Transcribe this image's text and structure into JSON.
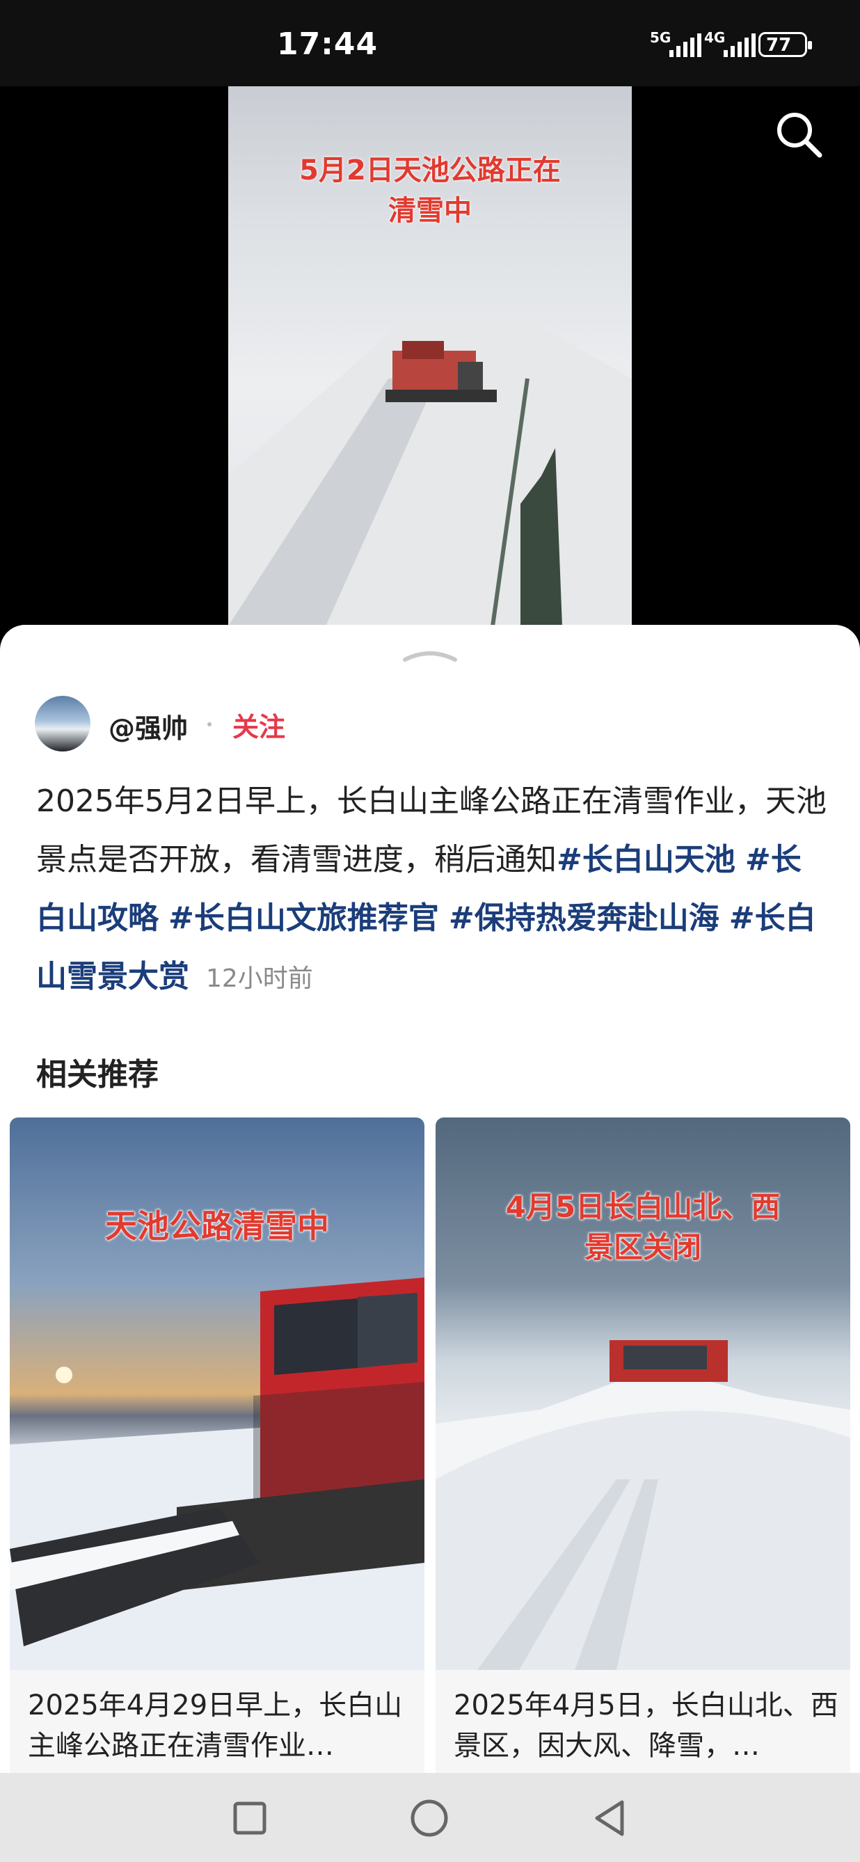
{
  "status_bar": {
    "time": "17:44",
    "signal_1_label": "5G",
    "signal_2_label": "4G",
    "battery": "77"
  },
  "video": {
    "overlay_title_line1": "5月2日天池公路正在",
    "overlay_title_line2": "清雪中",
    "search_icon": "search-icon"
  },
  "post": {
    "username": "@强帅",
    "follow_label": "关注",
    "text": "2025年5月2日早上，长白山主峰公路正在清雪作业，天池景点是否开放，看清雪进度，稍后通知",
    "tags": [
      "#长白山天池",
      "#长白山攻略",
      "#长白山文旅推荐官",
      "#保持热爱奔赴山海",
      "#长白山雪景大赏"
    ],
    "timestamp": "12小时前"
  },
  "related": {
    "title": "相关推荐",
    "cards": [
      {
        "overlay_title": "天池公路清雪中",
        "caption": "2025年4月29日早上，长白山主峰公路正在清雪作业…"
      },
      {
        "overlay_title_line1": "4月5日长白山北、西",
        "overlay_title_line2": "景区关闭",
        "caption": "2025年4月5日，长白山北、西景区，因大风、降雪，…"
      }
    ]
  },
  "nav_bar": {
    "icons": [
      "recents-square-icon",
      "home-circle-icon",
      "back-triangle-icon"
    ]
  },
  "colors": {
    "tag": "#1b3d7a",
    "follow": "#e6394a",
    "overlay_red": "#e23a2f"
  }
}
